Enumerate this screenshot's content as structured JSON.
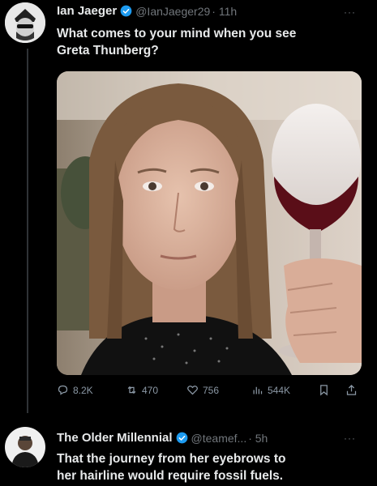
{
  "tweet": {
    "author_name": "Ian Jaeger",
    "author_handle": "@IanJaeger29",
    "time": "· 11h",
    "text_line1": "What comes to your mind when you see",
    "text_line2": "Greta Thunberg?",
    "more": "···"
  },
  "actions": {
    "replies": "8.2K",
    "retweets": "470",
    "likes": "756",
    "views": "544K"
  },
  "reply": {
    "author_name": "The Older Millennial",
    "author_handle": "@teamef...",
    "time": "· 5h",
    "text_line1": "That the journey from her eyebrows to",
    "text_line2": "her hairline would require fossil fuels.",
    "more": "···"
  },
  "colors": {
    "background": "#000000",
    "text": "#e7e9ea",
    "secondary": "#71767b",
    "verified": "#1d9bf0"
  }
}
